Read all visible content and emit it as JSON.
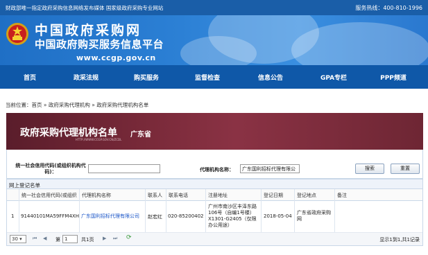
{
  "topbar": {
    "slogan": "财政部唯一指定政府采购信息网络发布媒体 国家级政府采购专业网站",
    "hotline": "服务热线：400-810-1996"
  },
  "header": {
    "title": "中国政府采购网",
    "subtitle": "中国政府购买服务信息平台",
    "url": "www.ccgp.gov.cn"
  },
  "nav": {
    "items": [
      "首页",
      "政采法规",
      "购买服务",
      "监督检查",
      "信息公告",
      "GPA专栏",
      "PPP频道"
    ]
  },
  "breadcrumb": "当前位置：首页 » 政府采购代理机构 » 政府采购代理机构名单",
  "panel": {
    "title": "政府采购代理机构名单",
    "province": "广东省",
    "subtitle": "HTTP://WWW.CCGP.GOV.CN/ZCDL"
  },
  "search": {
    "credit_code_label": "统一社会信用代码(或组织机构代码)：",
    "credit_code_value": "",
    "agency_name_label": "代理机构名称：",
    "agency_name_value": "广东国利招标代理有限公",
    "search_button": "搜索",
    "reset_button": "重置"
  },
  "grid": {
    "title": "网上登记名单",
    "columns": [
      "统一社会信用代码(或组织",
      "代理机构名称",
      "联系人",
      "联系电话",
      "注册地址",
      "登记日期",
      "登记地点",
      "备注"
    ],
    "rows": [
      {
        "index": "1",
        "credit_code": "91440101MA59FFM4XH",
        "name": "广东国利招标代理有限公司",
        "contact": "赵宏红",
        "phone": "020-85200402",
        "address": [
          "广州市南沙区丰泽东路",
          "106号（自编1号楼）",
          "X1301-G2405（仅限",
          "办公用途）"
        ],
        "date": "2018-05-04",
        "place": [
          "广东省政府采购",
          "网"
        ],
        "note": ""
      }
    ]
  },
  "pager": {
    "page_size": "30",
    "page_label": "第",
    "page_value": "1",
    "total_pages": "共1页",
    "info": "显示1到1,共1记录"
  },
  "colors": {
    "topbar": "#1a5ea8",
    "nav": "#0f58a8",
    "panel_head": "#7a2a3a",
    "link": "#1a55c8"
  }
}
